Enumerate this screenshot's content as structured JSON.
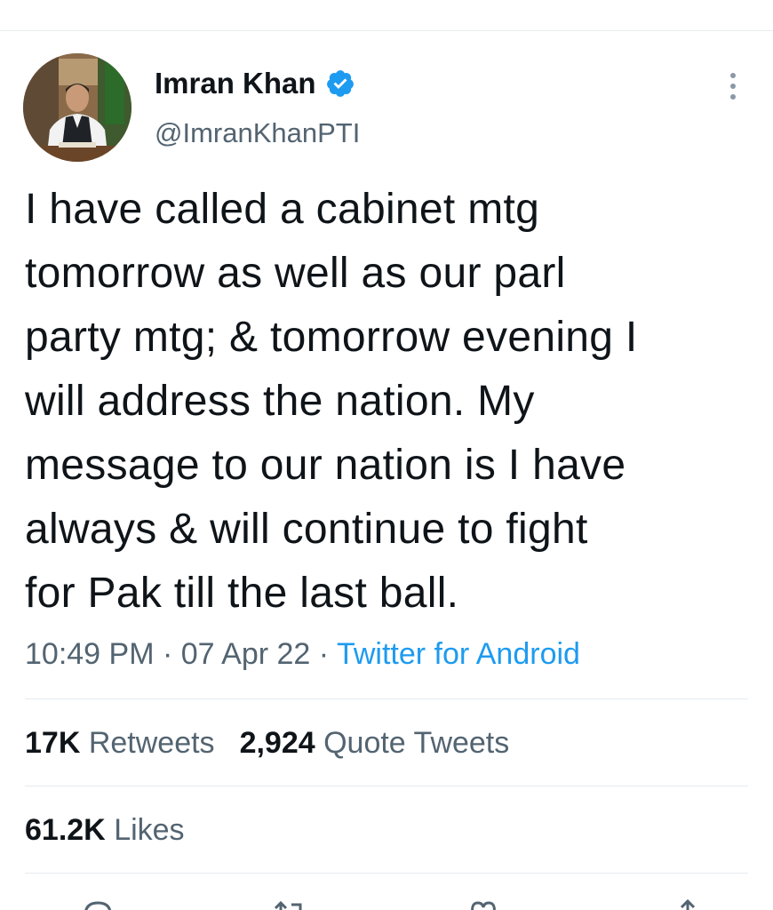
{
  "author": {
    "name": "Imran Khan",
    "handle": "@ImranKhanPTI",
    "verified": true
  },
  "tweet": {
    "lines": [
      "I have called a cabinet mtg",
      "tomorrow as well as our parl",
      "party mtg; & tomorrow evening I",
      "will address the nation. My",
      "message to our nation is I have",
      "always & will continue to fight",
      "for Pak till the last ball."
    ]
  },
  "meta": {
    "time": "10:49 PM",
    "date": "07 Apr 22",
    "separator": "·",
    "source": "Twitter for Android"
  },
  "stats": {
    "retweets_count": "17K",
    "retweets_label": "Retweets",
    "quotes_count": "2,924",
    "quotes_label": "Quote Tweets",
    "likes_count": "61.2K",
    "likes_label": "Likes"
  },
  "icons": {
    "verified": "verified-badge-icon",
    "more": "more-options-icon",
    "reply": "reply-icon",
    "retweet": "retweet-icon",
    "like": "heart-icon",
    "share": "share-icon"
  },
  "colors": {
    "accent": "#1d9bf0",
    "text": "#0f1419",
    "muted": "#536471",
    "divider": "#e6ecf0"
  }
}
